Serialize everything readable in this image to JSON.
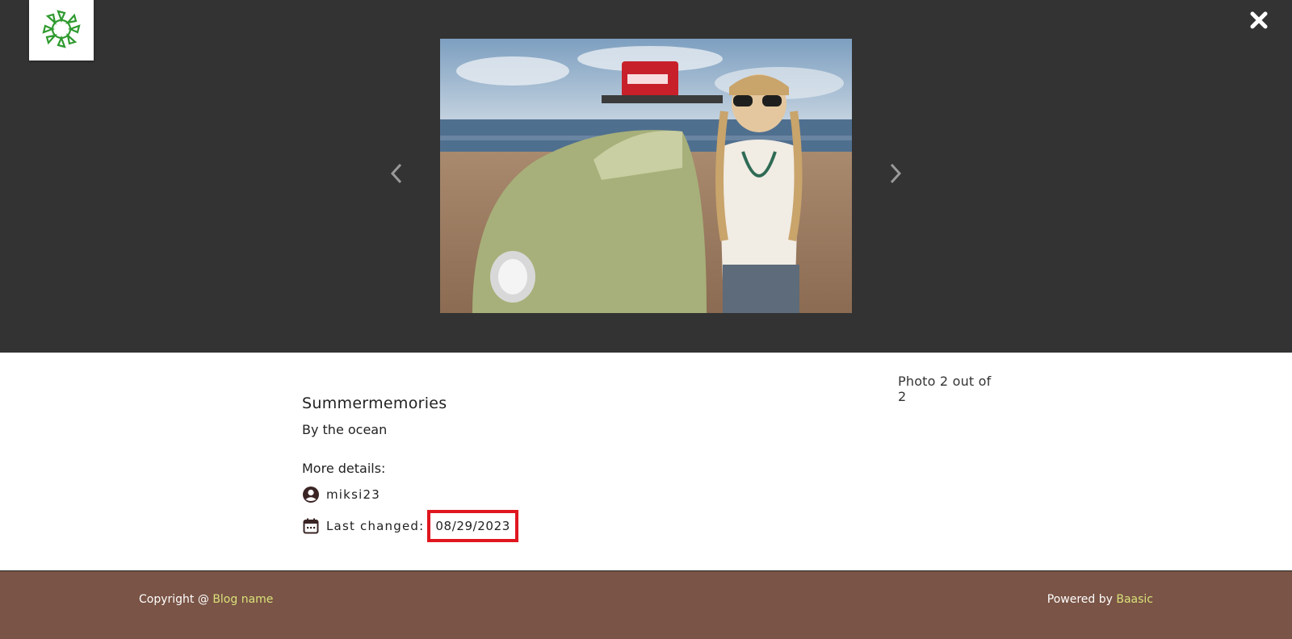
{
  "viewer": {
    "logo_icon": "sun-logo-icon",
    "close_icon": "close-icon",
    "prev_icon": "chevron-left-icon",
    "next_icon": "chevron-right-icon",
    "photo_alt": "Woman with sunglasses leaning on a green vintage car by the ocean, Coca-Cola cooler on the roof rack"
  },
  "details": {
    "counter": "Photo 2 out of 2",
    "title": "Summermemories",
    "subtitle": "By the ocean",
    "more_label": "More details:",
    "author": "miksi23",
    "last_changed_label": "Last changed:",
    "last_changed_value": "08/29/2023"
  },
  "footer": {
    "copyright_prefix": "Copyright @ ",
    "blog_link": "Blog name",
    "powered_prefix": "Powered by ",
    "powered_link": "Baasic"
  },
  "colors": {
    "viewer_bg": "#333333",
    "footer_bg": "#7a5446",
    "footer_link": "#d9e27a",
    "highlight_border": "#e0161f",
    "logo_green": "#2e9a2e"
  }
}
